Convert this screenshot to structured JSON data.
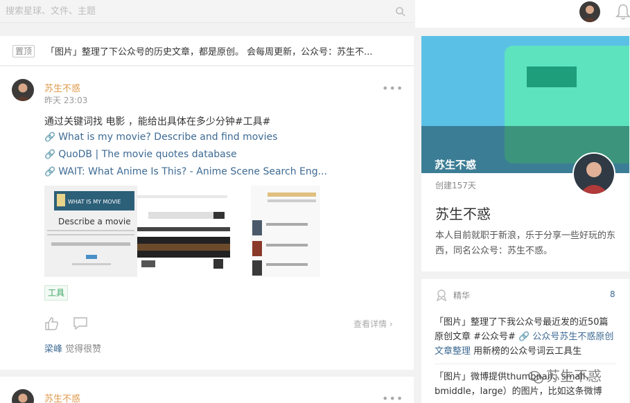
{
  "search": {
    "placeholder": "搜索星球、文件、主题"
  },
  "pinned": {
    "badge": "置顶",
    "text": "「图片」整理了下公众号的历史文章，都是原创。 会每周更新，公众号：苏生不..."
  },
  "post": {
    "author": "苏生不惑",
    "time": "昨天 23:03",
    "text": "通过关键词找 电影 ，能给出具体在多少分钟#工具#",
    "links": [
      "What is my movie? Describe and find movies",
      "QuoDB | The movie quotes database",
      "WAIT: What Anime Is This? - Anime Scene Search Eng..."
    ],
    "media": {
      "logo_text": "WHAT IS MY MOVIE",
      "headline": "Describe a movie"
    },
    "tag": "工具",
    "details": "查看详情",
    "liker_name": "梁峰",
    "liker_suffix": "觉得很赞"
  },
  "post2": {
    "author": "苏生不惑"
  },
  "profile": {
    "cover_name": "苏生不惑",
    "created": "创建157天",
    "name": "苏生不惑",
    "description": "本人目前就职于新浪，乐于分享一些好玩的东西，同名公众号：苏生不惑。"
  },
  "featured": {
    "title": "精华",
    "count": "8",
    "item1_a": "「图片」整理了下我公众号最近发的近50篇原创文章 #公众号# ",
    "item1_link": "公众号苏生不惑原创文章整理",
    "item1_b": " 用新榜的公众号词云工具生",
    "item2": "「图片」微博提供thumbnail、small，bmiddle，large）的图片，比如这条微博"
  },
  "watermark": "苏生不惑",
  "colors": {
    "author": "#e09a4c",
    "link": "#3d6a93",
    "tag": "#3aa662",
    "cover": "#5bc0e5"
  }
}
